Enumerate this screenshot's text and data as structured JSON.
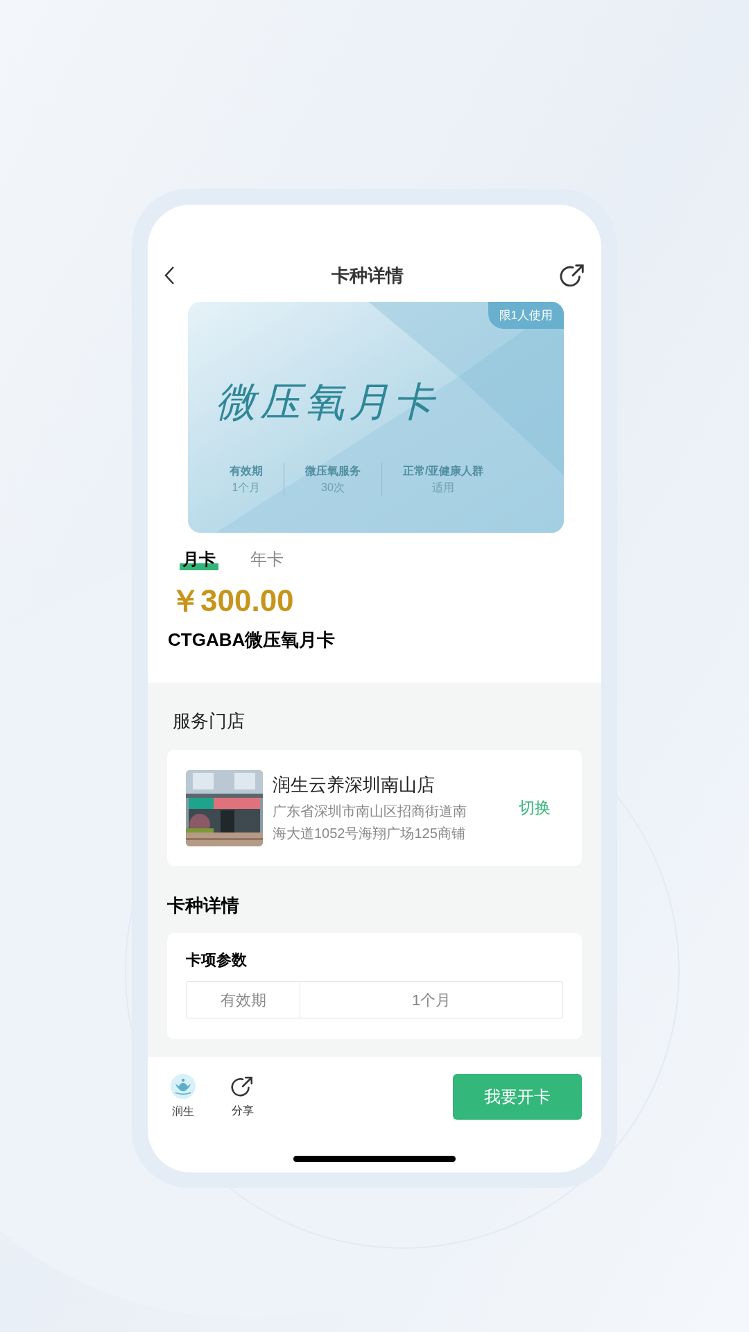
{
  "header": {
    "title": "卡种详情"
  },
  "card": {
    "badge": "限1人使用",
    "title": "微压氧月卡",
    "stats": [
      {
        "label": "有效期",
        "value": "1个月"
      },
      {
        "label": "微压氧服务",
        "value": "30次"
      },
      {
        "label": "正常/亚健康人群",
        "value": "适用"
      }
    ]
  },
  "tabs": [
    {
      "label": "月卡",
      "selected": true
    },
    {
      "label": "年卡",
      "selected": false
    }
  ],
  "price": "￥300.00",
  "product_name": "CTGABA微压氧月卡",
  "store_section": {
    "title": "服务门店",
    "store": {
      "name": "润生云养深圳南山店",
      "address": "广东省深圳市南山区招商街道南海大道1052号海翔广场125商铺",
      "action": "切换"
    }
  },
  "details_section": {
    "title": "卡种详情",
    "params": {
      "title": "卡项参数",
      "rows": [
        {
          "label": "有效期",
          "value": "1个月"
        }
      ]
    }
  },
  "bottom_bar": {
    "items": [
      {
        "kind": "brand",
        "label": "润生"
      },
      {
        "kind": "share",
        "label": "分享"
      }
    ],
    "button": "我要开卡"
  }
}
